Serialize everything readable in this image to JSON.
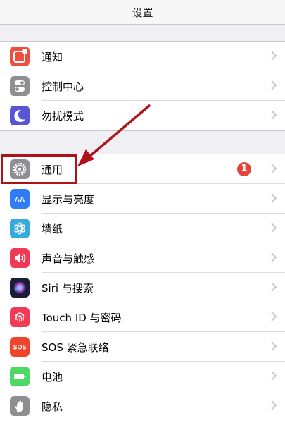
{
  "nav": {
    "title": "设置"
  },
  "groups": [
    {
      "items": [
        {
          "label": "通知",
          "icon": "notifications-icon",
          "color": "#f04d3f"
        },
        {
          "label": "控制中心",
          "icon": "control-center-icon",
          "color": "#8e8e93"
        },
        {
          "label": "勿扰模式",
          "icon": "do-not-disturb-icon",
          "color": "#5856d6"
        }
      ]
    },
    {
      "items": [
        {
          "label": "通用",
          "icon": "gear-icon",
          "color": "#8e8e93",
          "badge": "1",
          "highlighted": true
        },
        {
          "label": "显示与亮度",
          "icon": "display-brightness-icon",
          "color": "#2f7cf6"
        },
        {
          "label": "墙纸",
          "icon": "wallpaper-icon",
          "color": "#35aadc"
        },
        {
          "label": "声音与触感",
          "icon": "sounds-haptics-icon",
          "color": "#f03b56"
        },
        {
          "label": "Siri 与搜索",
          "icon": "siri-icon",
          "color": "#1c1c3a"
        },
        {
          "label": "Touch ID 与密码",
          "icon": "fingerprint-icon",
          "color": "#f03b56"
        },
        {
          "label": "SOS 紧急联络",
          "icon": "sos-icon",
          "color": "#f0452d",
          "icon_text": "SOS"
        },
        {
          "label": "电池",
          "icon": "battery-icon",
          "color": "#4cd964"
        },
        {
          "label": "隐私",
          "icon": "privacy-hand-icon",
          "color": "#8e8e93"
        }
      ]
    }
  ],
  "annotation": {
    "arrow_color": "#b1121a",
    "box_color": "#b1121a"
  }
}
